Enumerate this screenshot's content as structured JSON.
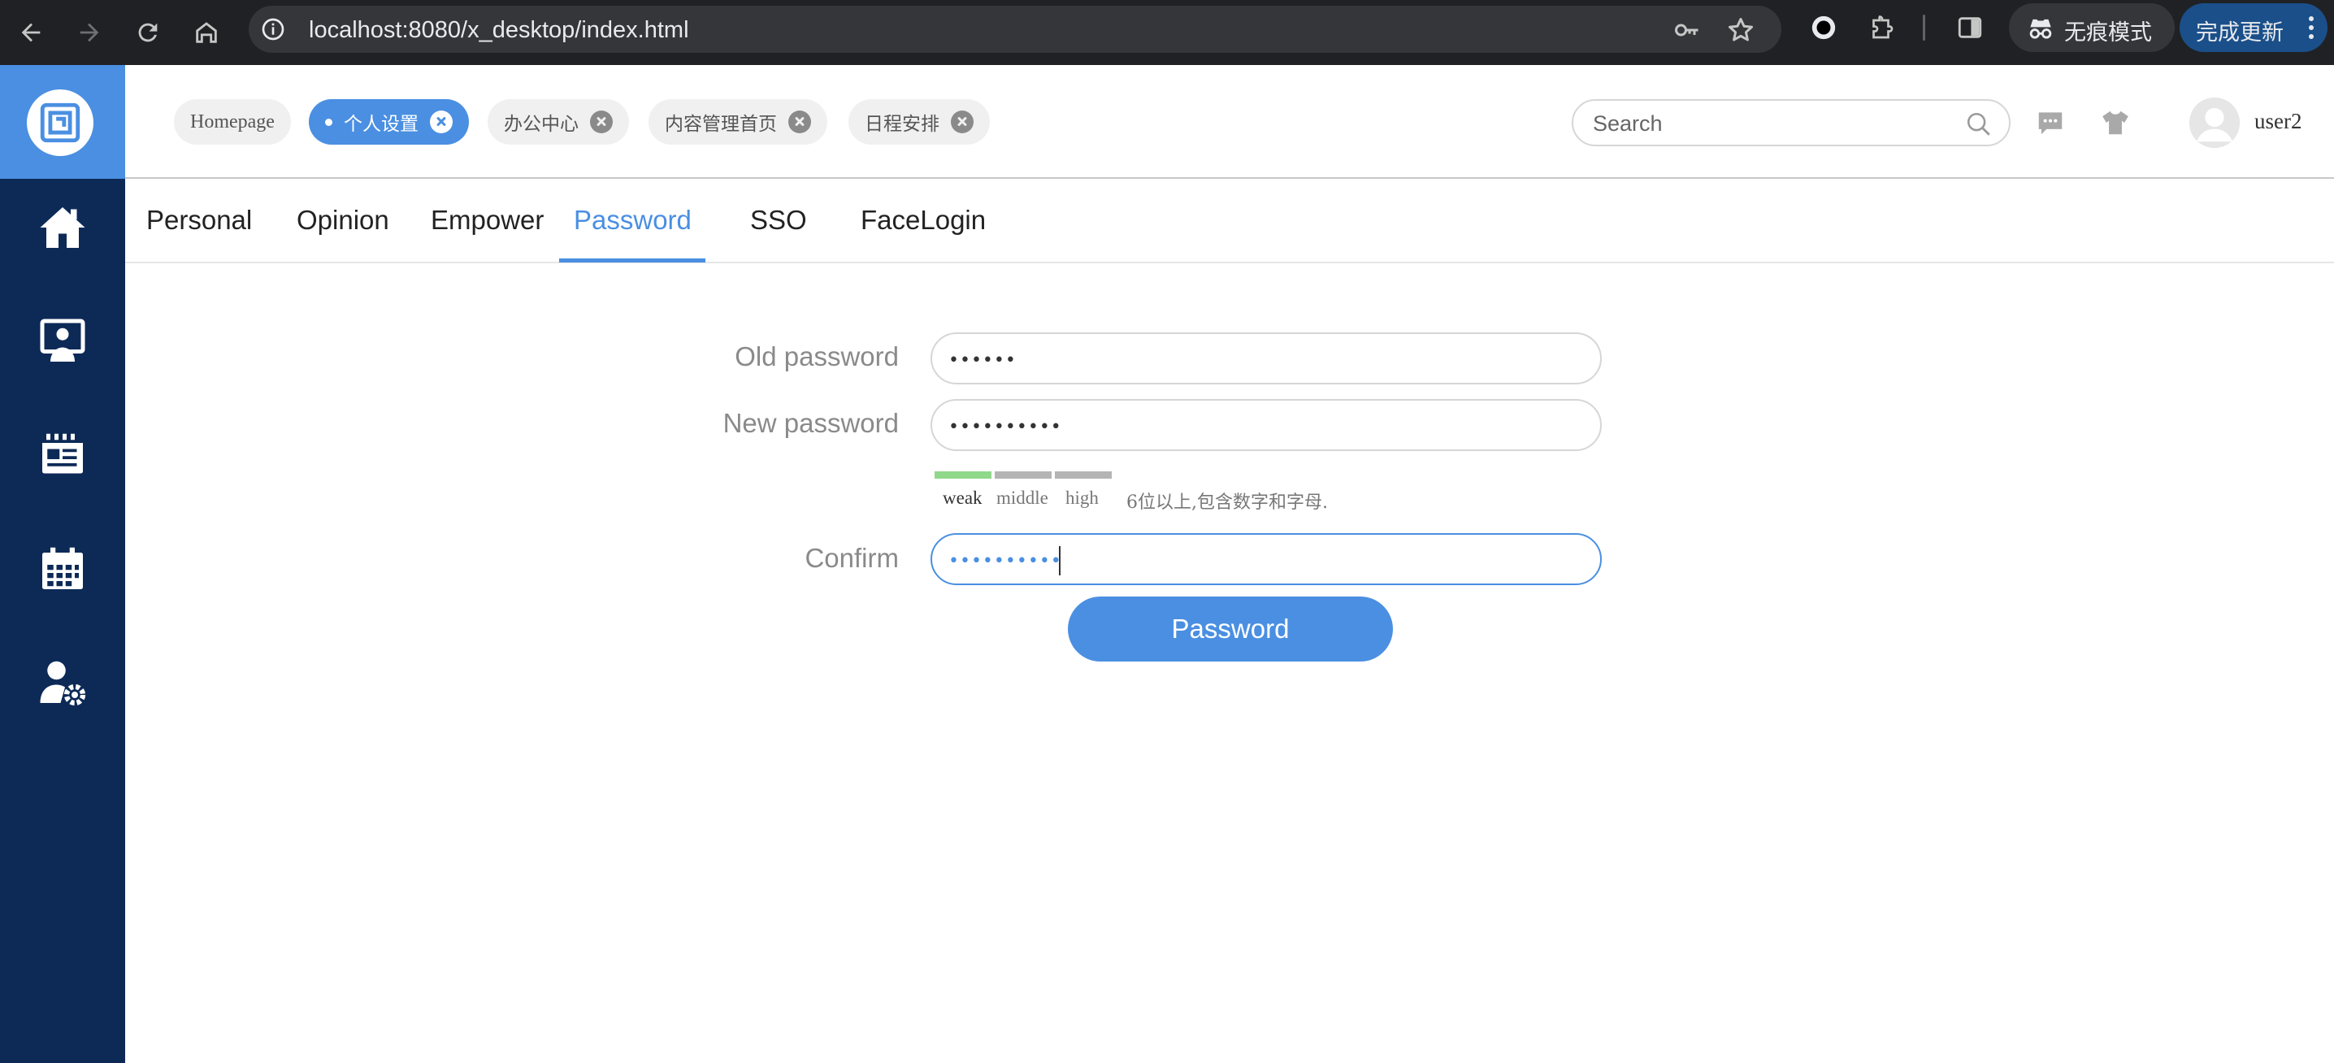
{
  "browser": {
    "url": "localhost:8080/x_desktop/index.html",
    "incognito_label": "无痕模式",
    "update_label": "完成更新"
  },
  "open_tabs": [
    {
      "label": "Homepage",
      "active": false,
      "closable": false
    },
    {
      "label": "个人设置",
      "active": true,
      "closable": true
    },
    {
      "label": "办公中心",
      "active": false,
      "closable": true
    },
    {
      "label": "内容管理首页",
      "active": false,
      "closable": true
    },
    {
      "label": "日程安排",
      "active": false,
      "closable": true
    }
  ],
  "header": {
    "search_placeholder": "Search",
    "username": "user2"
  },
  "content_tabs": [
    "Personal",
    "Opinion",
    "Empower",
    "Password",
    "SSO",
    "FaceLogin"
  ],
  "active_content_tab": "Password",
  "form": {
    "old_label": "Old password",
    "old_value": "••••••",
    "new_label": "New password",
    "new_value": "••••••••••",
    "confirm_label": "Confirm",
    "confirm_value": "••••••••••",
    "strength_levels": [
      "weak",
      "middle",
      "high"
    ],
    "strength_current": "weak",
    "hint": "6位以上,包含数字和字母.",
    "submit_label": "Password"
  },
  "colors": {
    "accent": "#4a8fe2",
    "sidebar": "#0d2a57",
    "strength_weak": "#90d88a"
  }
}
